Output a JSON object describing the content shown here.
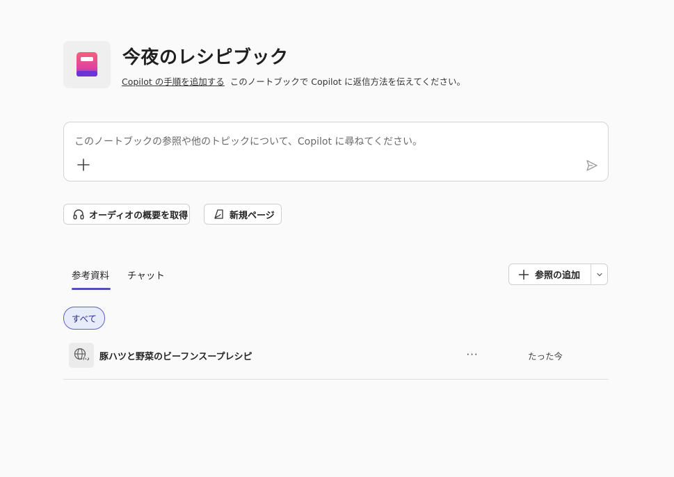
{
  "header": {
    "title": "今夜のレシピブック",
    "link_label": "Copilot の手順を追加する",
    "description": "このノートブックで Copilot に返信方法を伝えてください。",
    "icon": "notebook-icon"
  },
  "ask": {
    "placeholder": "このノートブックの参照や他のトピックについて、Copilot に尋ねてください。",
    "add_icon": "plus-icon",
    "send_icon": "send-icon"
  },
  "actions": {
    "audio_overview_label": "オーディオの概要を取得",
    "audio_icon": "headphones-icon",
    "new_page_label": "新規ページ",
    "new_page_icon": "new-page-icon"
  },
  "tabs": [
    {
      "label": "参考資料",
      "selected": true
    },
    {
      "label": "チャット",
      "selected": false
    }
  ],
  "add_source": {
    "label": "参照の追加",
    "icon": "plus-icon",
    "dropdown_icon": "chevron-down-icon"
  },
  "filters": [
    {
      "label": "すべて",
      "selected": true
    }
  ],
  "sources": [
    {
      "title": "豚ハツと野菜のビーフンスープレシピ",
      "icon": "web-link-icon",
      "more_label": "···",
      "time": "たった今"
    }
  ],
  "colors": {
    "background": "#fafafa",
    "accent": "#4f52b2",
    "chip_bg": "#e8ebfa",
    "notebook_icon_top": "#f05a8c",
    "notebook_icon_bottom": "#7b3fe4"
  }
}
